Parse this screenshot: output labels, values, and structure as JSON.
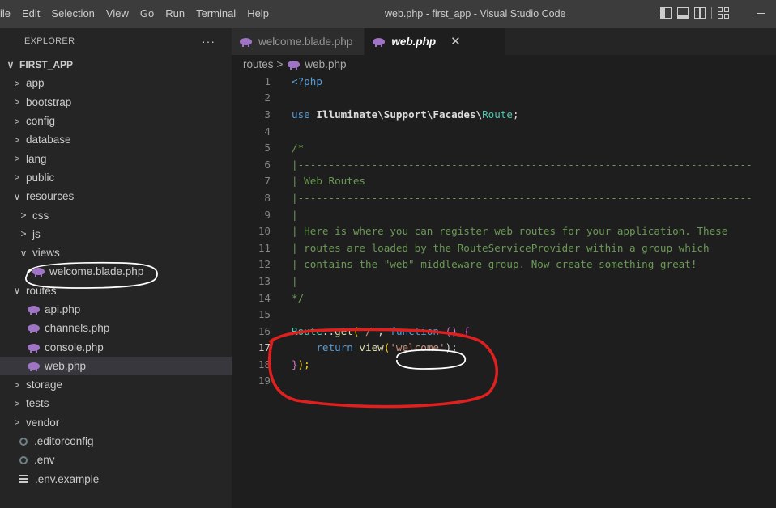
{
  "titlebar": {
    "menu": [
      "ile",
      "Edit",
      "Selection",
      "View",
      "Go",
      "Run",
      "Terminal",
      "Help"
    ],
    "window_title": "web.php - first_app - Visual Studio Code"
  },
  "sidebar": {
    "header": "EXPLORER",
    "more": "···",
    "root": "FIRST_APP",
    "items": [
      {
        "label": "app",
        "kind": "folder"
      },
      {
        "label": "bootstrap",
        "kind": "folder"
      },
      {
        "label": "config",
        "kind": "folder"
      },
      {
        "label": "database",
        "kind": "folder"
      },
      {
        "label": "lang",
        "kind": "folder"
      },
      {
        "label": "public",
        "kind": "folder"
      },
      {
        "label": "resources",
        "kind": "folder-open"
      },
      {
        "label": "css",
        "kind": "folder"
      },
      {
        "label": "js",
        "kind": "folder"
      },
      {
        "label": "views",
        "kind": "folder-open"
      },
      {
        "label": "welcome.blade.php",
        "kind": "php"
      },
      {
        "label": "routes",
        "kind": "folder-open"
      },
      {
        "label": "api.php",
        "kind": "php"
      },
      {
        "label": "channels.php",
        "kind": "php"
      },
      {
        "label": "console.php",
        "kind": "php"
      },
      {
        "label": "web.php",
        "kind": "php"
      },
      {
        "label": "storage",
        "kind": "folder"
      },
      {
        "label": "tests",
        "kind": "folder"
      },
      {
        "label": "vendor",
        "kind": "folder"
      },
      {
        "label": ".editorconfig",
        "kind": "gear"
      },
      {
        "label": ".env",
        "kind": "gear"
      },
      {
        "label": ".env.example",
        "kind": "list"
      }
    ]
  },
  "tabs": [
    {
      "label": "welcome.blade.php",
      "active": false
    },
    {
      "label": "web.php",
      "active": true
    }
  ],
  "breadcrumb": {
    "folder": "routes",
    "separator": ">",
    "file": "web.php"
  },
  "code": {
    "line_numbers": [
      "1",
      "2",
      "3",
      "4",
      "5",
      "6",
      "7",
      "8",
      "9",
      "10",
      "11",
      "12",
      "13",
      "14",
      "15",
      "16",
      "17",
      "18",
      "19"
    ],
    "l1": "<?php",
    "l3_use": "use ",
    "l3_ns": "Illuminate\\Support\\Facades\\",
    "l3_cls": "Route",
    "l3_end": ";",
    "l5": "/*",
    "l6": "|--------------------------------------------------------------------------",
    "l7": "| Web Routes",
    "l8": "|--------------------------------------------------------------------------",
    "l9": "|",
    "l10": "| Here is where you can register web routes for your application. These",
    "l11": "| routes are loaded by the RouteServiceProvider within a group which",
    "l12": "| contains the \"web\" middleware group. Now create something great!",
    "l13": "|",
    "l14": "*/",
    "l16_a": "Route",
    "l16_b": "::",
    "l16_c": "get",
    "l16_d": "(",
    "l16_e": "'/'",
    "l16_f": ", ",
    "l16_g": "function",
    "l16_h": " () {",
    "l17_a": "    return ",
    "l17_b": "view",
    "l17_c": "(",
    "l17_d": "'welcome'",
    "l17_e": ");",
    "l18_a": "}",
    "l18_b": ");"
  },
  "colors": {
    "annotation_red": "#e0201e",
    "annotation_white": "#ffffff"
  }
}
